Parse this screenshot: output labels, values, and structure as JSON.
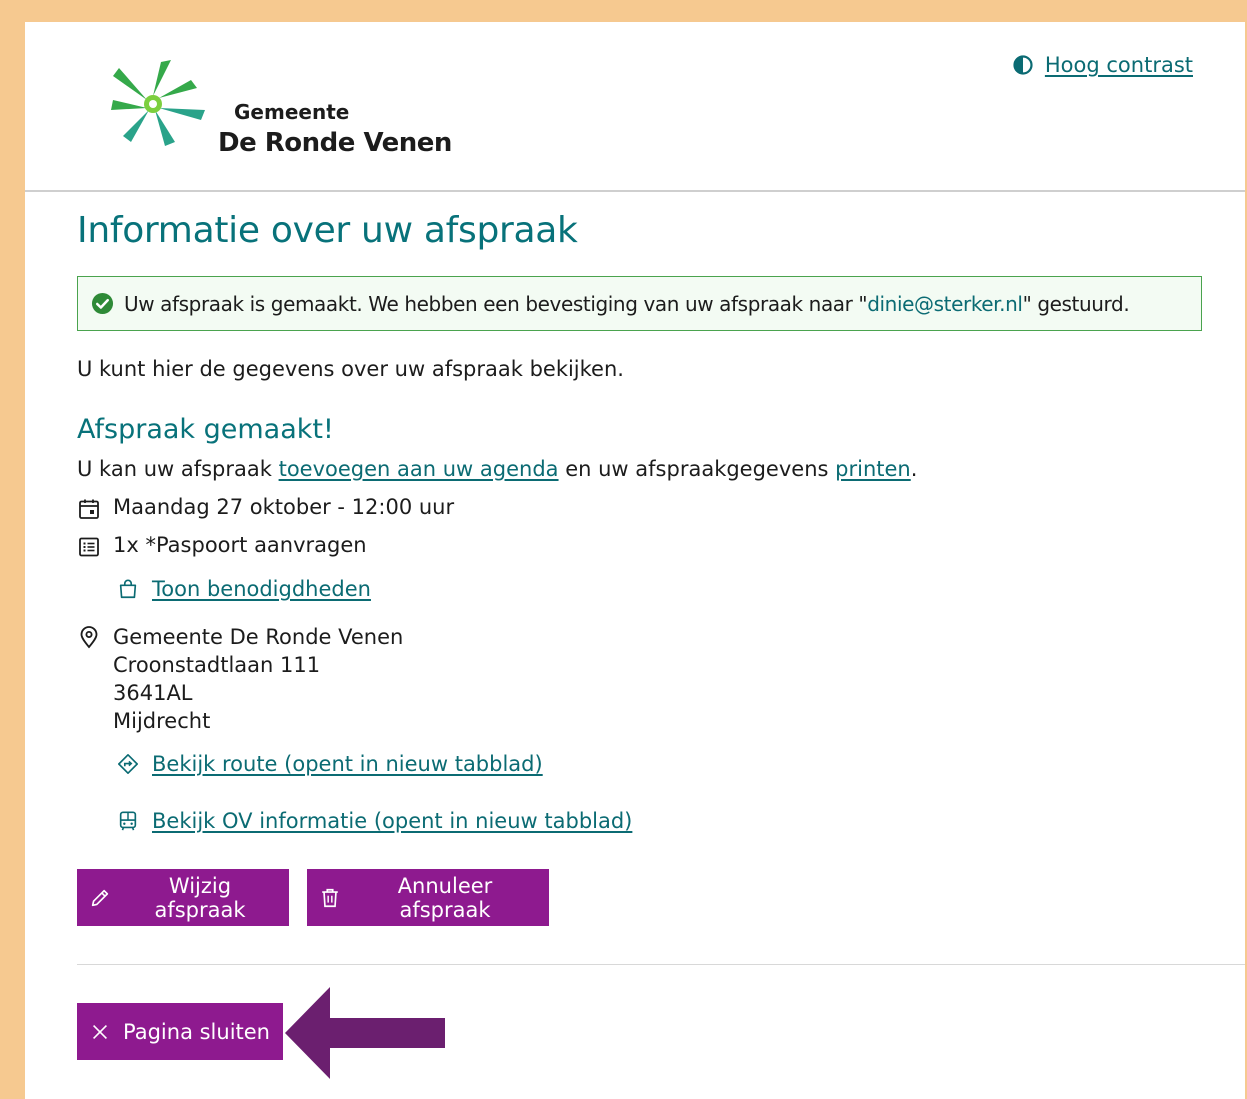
{
  "header": {
    "municipality_line1": "Gemeente",
    "municipality_line2": "De Ronde Venen",
    "contrast_label": "Hoog contrast"
  },
  "page": {
    "title": "Informatie over uw afspraak",
    "alert_text_before": "Uw afspraak is gemaakt. We hebben een bevestiging van uw afspraak naar \"",
    "alert_email": "dinie@sterker.nl",
    "alert_text_after": "\" gestuurd.",
    "intro": "U kunt hier de gegevens over uw afspraak bekijken."
  },
  "appointment": {
    "heading": "Afspraak gemaakt!",
    "hint_before": "U kan uw afspraak ",
    "hint_link_agenda": "toevoegen aan uw agenda",
    "hint_middle": " en uw afspraakgegevens ",
    "hint_link_print": "printen",
    "hint_after": ".",
    "datetime": "Maandag 27 oktober - 12:00 uur",
    "product": "1x *Paspoort aanvragen",
    "requirements_link": "Toon benodigdheden",
    "location": {
      "name": "Gemeente De Ronde Venen",
      "street": "Croonstadtlaan 111",
      "postcode": "3641AL",
      "city": "Mijdrecht"
    },
    "route_link": "Bekijk route (opent in nieuw tabblad)",
    "ov_link": "Bekijk OV informatie (opent in nieuw tabblad)"
  },
  "actions": {
    "edit_label": "Wijzig afspraak",
    "cancel_label": "Annuleer afspraak",
    "close_label": "Pagina sluiten"
  },
  "icons": {
    "contrast": "contrast-icon",
    "success": "check-circle-icon",
    "date": "calendar-icon",
    "product": "list-icon",
    "requirements": "shopping-bag-icon",
    "location": "map-pin-icon",
    "route": "route-diamond-icon",
    "ov": "bus-icon",
    "edit": "pencil-icon",
    "cancel": "trash-icon",
    "close": "close-icon",
    "annotation": "arrow-left-icon"
  },
  "colors": {
    "frame_background": "#f6c990",
    "accent_teal": "#08727a",
    "button_purple": "#8e1a8f",
    "annotation_arrow": "#6b1f6f",
    "success_green": "#2e8a37",
    "alert_background": "#f3fbf3"
  }
}
